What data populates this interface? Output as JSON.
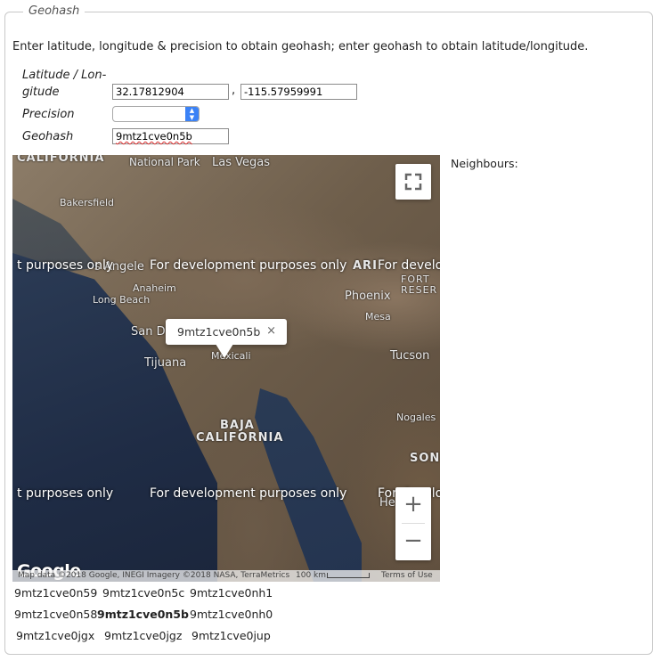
{
  "legend": "Geohash",
  "instructions": "Enter latitude, longitude & precision to obtain geohash; enter geohash to obtain latitude/longitude.",
  "form": {
    "latlon_label_line1": "Latitude / Lon-",
    "latlon_label_line2": "gitude",
    "latitude_value": "32.17812904",
    "comma": ",",
    "longitude_value": "-115.57959991",
    "precision_label": "Precision",
    "precision_value": "",
    "geohash_label": "Geohash",
    "geohash_value": "9mtz1cve0n5b"
  },
  "map": {
    "labels": {
      "california": "CALIFORNIA",
      "national_park": "National Park",
      "las_vegas": "Las Vegas",
      "bakersfield": "Bakersfield",
      "los_angeles": "s Angele",
      "anaheim": "Anaheim",
      "long_beach": "Long Beach",
      "arizona": "ARI",
      "fort": "FORT",
      "reser": "RESER",
      "phoenix": "Phoenix",
      "mesa": "Mesa",
      "san_diego": "San D",
      "tijuana": "Tijuana",
      "mexicali": "Mexicali",
      "tucson": "Tucson",
      "nogales": "Nogales",
      "baja": "BAJA",
      "baja_california": "CALIFORNIA",
      "son": "SON",
      "he": "He"
    },
    "watermarks": {
      "left": "t purposes only",
      "center": "For development purposes only",
      "right": "For develop"
    },
    "popup_text": "9mtz1cve0n5b",
    "popup_close": "×",
    "zoom_in": "+",
    "zoom_out": "−",
    "google_logo": "Google",
    "attribution": "Map data ©2018 Google, INEGI Imagery ©2018 NASA, TerraMetrics",
    "scale": "100 km",
    "terms": "Terms of Use"
  },
  "neighbours_label": "Neighbours:",
  "neighbours": [
    [
      "9mtz1cve0n59",
      "9mtz1cve0n5c",
      "9mtz1cve0nh1"
    ],
    [
      "9mtz1cve0n58",
      "9mtz1cve0n5b",
      "9mtz1cve0nh0"
    ],
    [
      "9mtz1cve0jgx",
      "9mtz1cve0jgz",
      "9mtz1cve0jup"
    ]
  ],
  "colors": {
    "select_accent": "#3b82f6",
    "spellcheck": "#d33"
  }
}
